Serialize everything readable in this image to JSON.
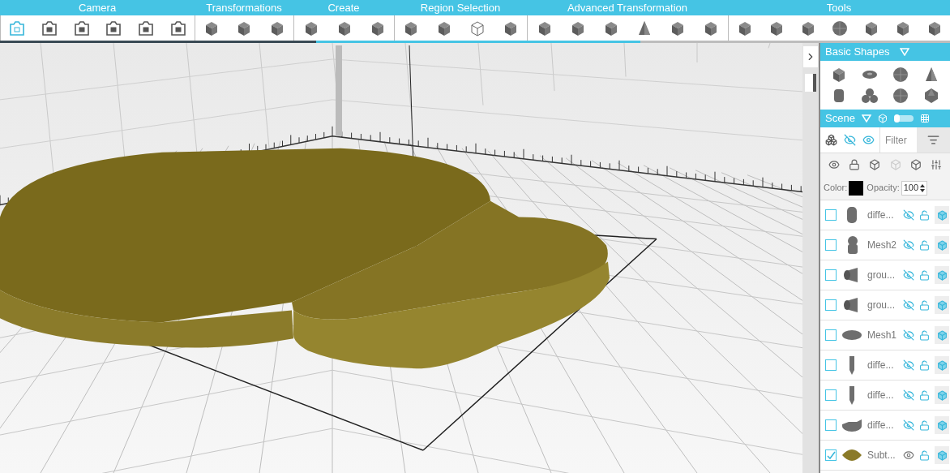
{
  "toolbar": {
    "groups": [
      {
        "label": "Camera",
        "tools": [
          {
            "kind": "camera",
            "selected": true
          },
          {
            "kind": "camera",
            "selected": false
          },
          {
            "kind": "camera",
            "selected": false
          },
          {
            "kind": "camera",
            "selected": false
          },
          {
            "kind": "camera",
            "selected": false
          },
          {
            "kind": "camera",
            "selected": false
          }
        ]
      },
      {
        "label": "Transformations",
        "tools": [
          {
            "kind": "cube",
            "selected": false
          },
          {
            "kind": "cube",
            "selected": false
          },
          {
            "kind": "cube",
            "selected": false
          }
        ]
      },
      {
        "label": "Create",
        "tools": [
          {
            "kind": "cube",
            "selected": false
          },
          {
            "kind": "cube",
            "selected": false
          },
          {
            "kind": "cube",
            "selected": false
          }
        ]
      },
      {
        "label": "Region Selection",
        "tools": [
          {
            "kind": "cube",
            "selected": false
          },
          {
            "kind": "cube",
            "selected": false
          },
          {
            "kind": "wire",
            "selected": false
          },
          {
            "kind": "cube",
            "selected": false
          }
        ]
      },
      {
        "label": "Advanced Transformation",
        "tools": [
          {
            "kind": "cube",
            "selected": false
          },
          {
            "kind": "cube",
            "selected": false
          },
          {
            "kind": "cube",
            "selected": false
          },
          {
            "kind": "cone",
            "selected": false
          },
          {
            "kind": "cube",
            "selected": false
          },
          {
            "kind": "cube",
            "selected": false
          }
        ]
      },
      {
        "label": "Tools",
        "tools": [
          {
            "kind": "cube",
            "selected": false
          },
          {
            "kind": "cube",
            "selected": false
          },
          {
            "kind": "cube",
            "selected": false
          },
          {
            "kind": "sphere",
            "selected": false
          },
          {
            "kind": "cube",
            "selected": false
          },
          {
            "kind": "cube",
            "selected": false
          },
          {
            "kind": "cube",
            "selected": false
          }
        ]
      }
    ]
  },
  "basic_shapes": {
    "title": "Basic Shapes"
  },
  "scene": {
    "title": "Scene",
    "grid_view": false,
    "filter_placeholder": "Filter",
    "color_label": "Color:",
    "color": "#000000",
    "opacity_label": "Opacity:",
    "opacity": "100",
    "items": [
      {
        "name": "diffe...",
        "kind": "cylinder",
        "checked": false,
        "visible": false
      },
      {
        "name": "Mesh2",
        "kind": "figure",
        "checked": false,
        "visible": false
      },
      {
        "name": "grou...",
        "kind": "tube",
        "checked": false,
        "visible": false
      },
      {
        "name": "grou...",
        "kind": "tube",
        "checked": false,
        "visible": false
      },
      {
        "name": "Mesh1",
        "kind": "disc",
        "checked": false,
        "visible": false
      },
      {
        "name": "diffe...",
        "kind": "pin",
        "checked": false,
        "visible": false
      },
      {
        "name": "diffe...",
        "kind": "pin",
        "checked": false,
        "visible": false
      },
      {
        "name": "diffe...",
        "kind": "cutdisc",
        "checked": false,
        "visible": false
      },
      {
        "name": "Subt...",
        "kind": "plate",
        "checked": true,
        "visible": true
      }
    ]
  }
}
